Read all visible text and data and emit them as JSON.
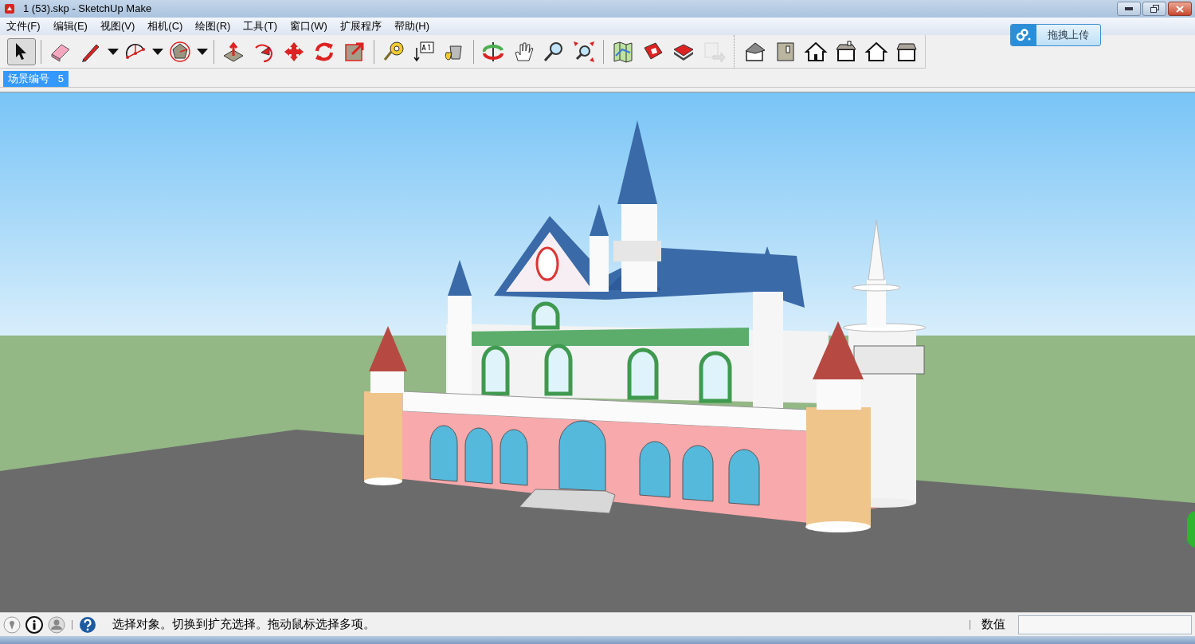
{
  "window": {
    "title": "1 (53).skp - SketchUp Make"
  },
  "menu": [
    "文件(F)",
    "编辑(E)",
    "视图(V)",
    "相机(C)",
    "绘图(R)",
    "工具(T)",
    "窗口(W)",
    "扩展程序",
    "帮助(H)"
  ],
  "toolbar": [
    {
      "kind": "select",
      "selected": true
    },
    {
      "kind": "separator"
    },
    {
      "kind": "eraser",
      "selected": false
    },
    {
      "kind": "pencil",
      "selected": false,
      "dropdown": true
    },
    {
      "kind": "arc",
      "selected": false,
      "dropdown": true
    },
    {
      "kind": "polygon",
      "selected": false,
      "dropdown": true
    },
    {
      "kind": "separator"
    },
    {
      "kind": "pushpull",
      "selected": false
    },
    {
      "kind": "followme",
      "selected": false
    },
    {
      "kind": "move",
      "selected": false
    },
    {
      "kind": "rotate",
      "selected": false
    },
    {
      "kind": "scale",
      "selected": false
    },
    {
      "kind": "separator"
    },
    {
      "kind": "tape",
      "selected": false
    },
    {
      "kind": "text",
      "selected": false
    },
    {
      "kind": "paint",
      "selected": false
    },
    {
      "kind": "separator"
    },
    {
      "kind": "orbit",
      "selected": false
    },
    {
      "kind": "pan",
      "selected": false
    },
    {
      "kind": "zoom",
      "selected": false
    },
    {
      "kind": "extents",
      "selected": false
    },
    {
      "kind": "separator"
    },
    {
      "kind": "map",
      "selected": false
    },
    {
      "kind": "warehouse",
      "selected": false
    },
    {
      "kind": "share",
      "selected": false
    },
    {
      "kind": "export",
      "selected": false,
      "disabled": true
    },
    {
      "kind": "gap"
    },
    {
      "kind": "iso",
      "selected": false
    },
    {
      "kind": "side",
      "selected": false
    },
    {
      "kind": "front",
      "selected": false
    },
    {
      "kind": "right",
      "selected": false
    },
    {
      "kind": "back",
      "selected": false
    },
    {
      "kind": "left",
      "selected": false
    }
  ],
  "upload_button": {
    "label": "拖拽上传"
  },
  "scene_tabs": [
    {
      "label": "场景编号",
      "number": "5",
      "selected": true
    }
  ],
  "status_bar": {
    "message": "选择对象。切换到扩充选择。拖动鼠标选择多项。",
    "measurement_label": "数值"
  }
}
